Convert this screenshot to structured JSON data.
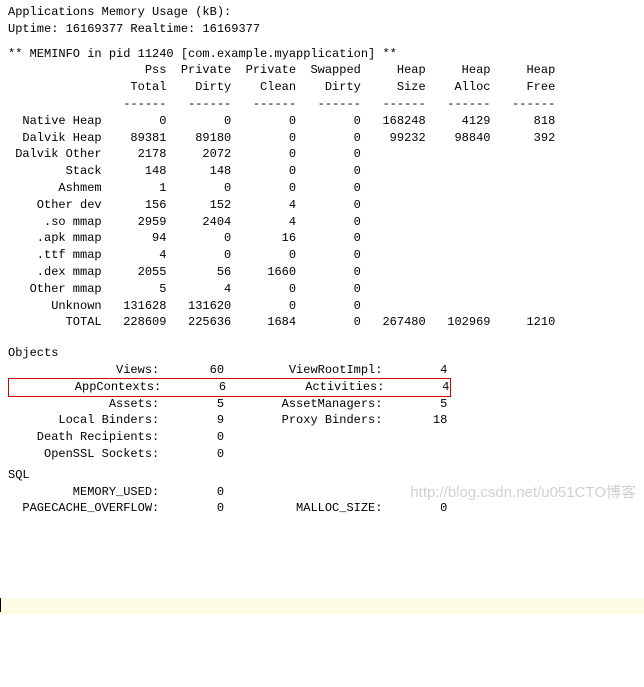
{
  "header": {
    "line1": "Applications Memory Usage (kB):",
    "line2": "Uptime: 16169377 Realtime: 16169377"
  },
  "meminfo": {
    "title": "** MEMINFO in pid 11240 [com.example.myapplication] **",
    "cols_line1": "                   Pss  Private  Private  Swapped     Heap     Heap     Heap",
    "cols_line2": "                 Total    Dirty    Clean    Dirty     Size    Alloc     Free",
    "divider": "                ------   ------   ------   ------   ------   ------   ------",
    "rows": [
      "  Native Heap        0        0        0        0   168248     4129      818",
      "  Dalvik Heap    89381    89180        0        0    99232    98840      392",
      " Dalvik Other     2178     2072        0        0",
      "        Stack      148      148        0        0",
      "       Ashmem        1        0        0        0",
      "    Other dev      156      152        4        0",
      "     .so mmap     2959     2404        4        0",
      "    .apk mmap       94        0       16        0",
      "    .ttf mmap        4        0        0        0",
      "    .dex mmap     2055       56     1660        0",
      "   Other mmap        5        4        0        0",
      "      Unknown   131628   131620        0        0",
      "        TOTAL   228609   225636     1684        0   267480   102969     1210"
    ]
  },
  "objects": {
    "title": " Objects",
    "rows": [
      "               Views:       60         ViewRootImpl:        4",
      "         AppContexts:        6           Activities:        4",
      "              Assets:        5        AssetManagers:        5",
      "       Local Binders:        9        Proxy Binders:       18",
      "    Death Recipients:        0",
      "     OpenSSL Sockets:        0"
    ]
  },
  "sql": {
    "title": " SQL",
    "rows": [
      "         MEMORY_USED:        0",
      "  PAGECACHE_OVERFLOW:        0          MALLOC_SIZE:        0"
    ]
  },
  "watermark": {
    "url": "http://blog.csdn.net/u051CTO博客"
  }
}
